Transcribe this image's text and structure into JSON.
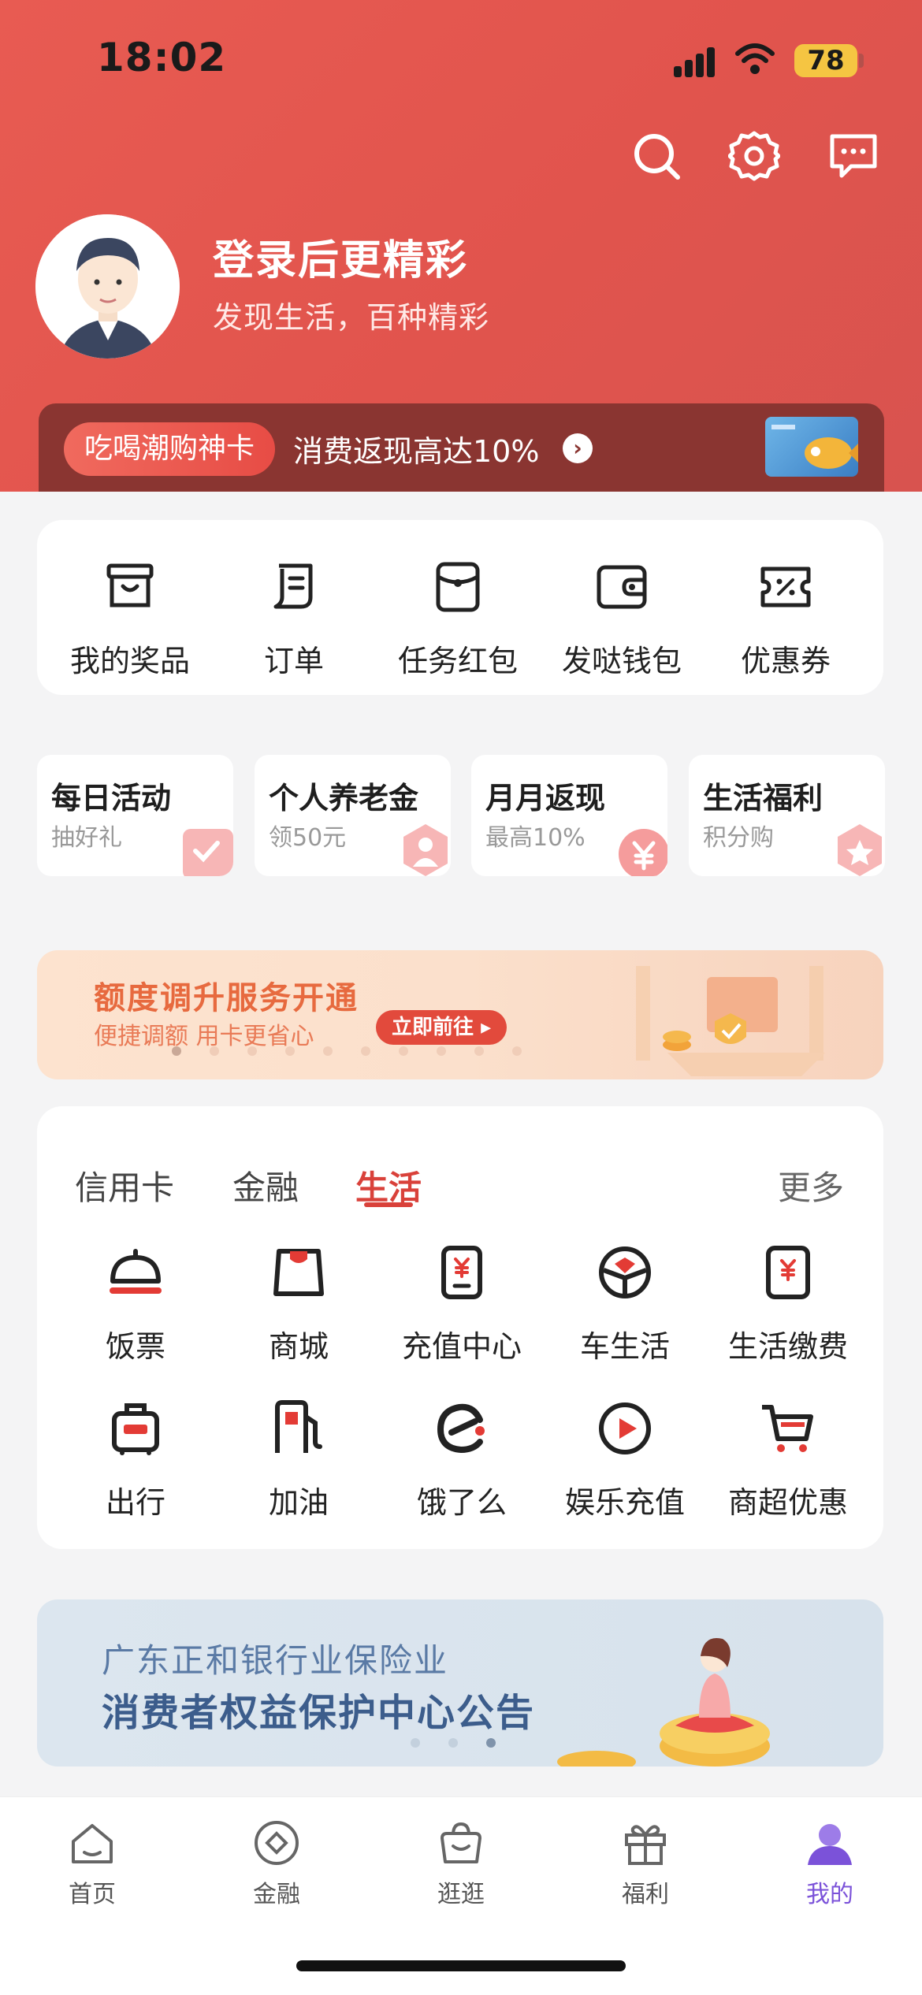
{
  "status_bar": {
    "time": "18:02",
    "battery": "78"
  },
  "profile": {
    "title": "登录后更精彩",
    "subtitle": "发现生活，百种精彩"
  },
  "promo": {
    "tag": "吃喝潮购神卡",
    "text": "消费返现高达10%"
  },
  "quick_actions": [
    {
      "label": "我的奖品",
      "icon": "prize-box-icon"
    },
    {
      "label": "订单",
      "icon": "order-icon"
    },
    {
      "label": "任务红包",
      "icon": "red-envelope-icon"
    },
    {
      "label": "发哒钱包",
      "icon": "wallet-icon"
    },
    {
      "label": "优惠券",
      "icon": "coupon-icon"
    }
  ],
  "activity_tiles": [
    {
      "title": "每日活动",
      "sub": "抽好礼",
      "icon": "check-icon"
    },
    {
      "title": "个人养老金",
      "sub": "领50元",
      "icon": "person-icon"
    },
    {
      "title": "月月返现",
      "sub": "最高10%",
      "icon": "yen-icon"
    },
    {
      "title": "生活福利",
      "sub": "积分购",
      "icon": "star-icon"
    }
  ],
  "banner_credit": {
    "title": "额度调升服务开通",
    "subtitle": "便捷调额 用卡更省心",
    "button": "立即前往"
  },
  "services": {
    "tabs": [
      "信用卡",
      "金融",
      "生活"
    ],
    "active_tab": "生活",
    "more": "更多",
    "items": [
      {
        "label": "饭票",
        "icon": "cloche-icon"
      },
      {
        "label": "商城",
        "icon": "shopping-bag-icon"
      },
      {
        "label": "充值中心",
        "icon": "phone-topup-icon"
      },
      {
        "label": "车生活",
        "icon": "steering-wheel-icon"
      },
      {
        "label": "生活缴费",
        "icon": "bill-icon"
      },
      {
        "label": "出行",
        "icon": "luggage-icon"
      },
      {
        "label": "加油",
        "icon": "fuel-pump-icon"
      },
      {
        "label": "饿了么",
        "icon": "eleme-icon"
      },
      {
        "label": "娱乐充值",
        "icon": "play-icon"
      },
      {
        "label": "商超优惠",
        "icon": "cart-icon"
      }
    ]
  },
  "banner_notice": {
    "line1": "广东正和银行业保险业",
    "line2": "消费者权益保护中心公告"
  },
  "bottom_nav": [
    {
      "label": "首页",
      "icon": "home-icon"
    },
    {
      "label": "金融",
      "icon": "finance-icon"
    },
    {
      "label": "逛逛",
      "icon": "bag-icon"
    },
    {
      "label": "福利",
      "icon": "gift-icon"
    },
    {
      "label": "我的",
      "icon": "profile-icon"
    }
  ],
  "bottom_nav_active": "我的",
  "colors": {
    "brand_red": "#E3564F",
    "accent_red": "#D9413A",
    "active_nav": "#7B52D9"
  }
}
